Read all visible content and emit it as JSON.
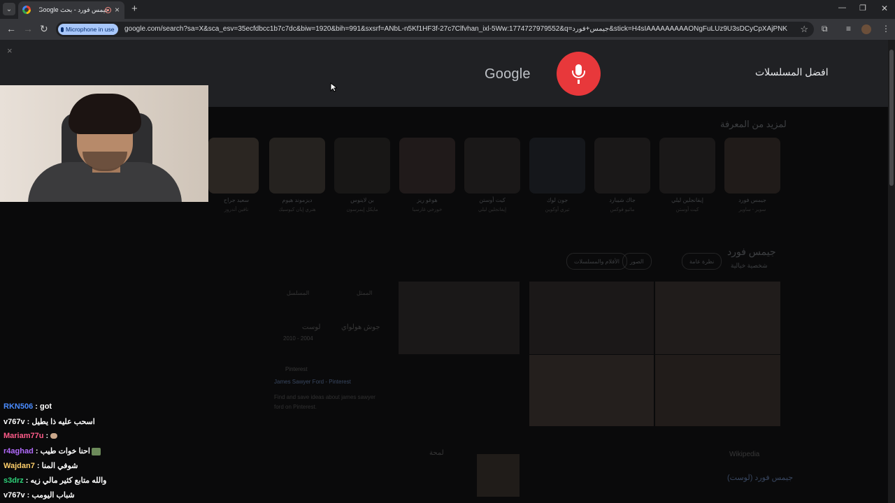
{
  "browser": {
    "tab": {
      "title": "جيمس فورد - بحث Google"
    },
    "new_tab_glyph": "+",
    "tab_close_glyph": "×",
    "mic_chip": "Microphone in use",
    "url": "google.com/search?sa=X&sca_esv=35ecfdbcc1b7c7dc&biw=1920&bih=991&sxsrf=ANbL-n5Kf1HF3f-27c7Clfvhan_ixl-5Ww:1774727979552&q=جيمس+فورد&stick=H4sIAAAAAAAAAONgFuLUz9U3sDCyCpXAjPNKkosDLRkspOt9Ev..."
  },
  "voice": {
    "close_glyph": "×",
    "logo": "Google",
    "transcript": "افضل المسلسلات"
  },
  "results": {
    "section_title": "لمزيد من المعرفة",
    "cards": [
      {
        "name": "جيمس فورد",
        "sub": "سوير - ساوير"
      },
      {
        "name": "إيفانجلين ليلي",
        "sub": "كيت أوستن"
      },
      {
        "name": "جاك شيبارد",
        "sub": "ماثيو فوكس"
      },
      {
        "name": "جون لوك",
        "sub": "تيري أوكوين"
      },
      {
        "name": "كيت أوستن",
        "sub": "إيفانجلين ليلي"
      },
      {
        "name": "هوغو ريز",
        "sub": "خورخي غارسيا"
      },
      {
        "name": "بن لاينوس",
        "sub": "مايكل إيمرسون"
      },
      {
        "name": "ديزموند هيوم",
        "sub": "هنري إيان كيوسيك"
      },
      {
        "name": "سعيد جراح",
        "sub": "نافين أندروز"
      }
    ],
    "entity_title": "جيمس فورد",
    "entity_sub": "شخصية خيالية",
    "chips": [
      "نظرة عامة",
      "الصور",
      "الأفلام والمسلسلات"
    ],
    "info": [
      "المسلسل",
      "لوست",
      "2004 - 2010",
      "جوش هولواي",
      "الممثل"
    ],
    "snippet_source": "Pinterest",
    "snippet_title": "James Sawyer Ford - Pinterest",
    "snippet_text": "Find and save ideas about james sawyer ford on Pinterest.",
    "wiki_source": "Wikipedia",
    "wiki_title": "جيمس فورد (لوست)",
    "see_more": "لمحة"
  },
  "chat": [
    {
      "user": "RKN506",
      "color": "#4a8cff",
      "text": "got"
    },
    {
      "user": "v767v",
      "color": "#ffffff",
      "text": "اسحب عليه ذا يطيل"
    },
    {
      "user": "Mariam77u",
      "color": "#ff5c8a",
      "text": ""
    },
    {
      "user": "r4aghad",
      "color": "#b36bff",
      "text": "احنا خوات طيب"
    },
    {
      "user": "Wajdan7",
      "color": "#ffcf6b",
      "text": "شوفي المنا"
    },
    {
      "user": "s3drz",
      "color": "#2ed37a",
      "text": "والله متابع كثير مالي زيه"
    },
    {
      "user": "v767v",
      "color": "#ffffff",
      "text": "شباب اليومب"
    }
  ]
}
